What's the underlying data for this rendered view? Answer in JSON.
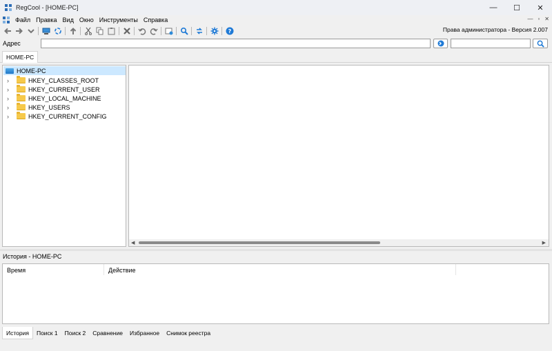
{
  "window": {
    "title": "RegCool - [HOME-PC]",
    "controls": {
      "minimize": "—",
      "maximize": "☐",
      "close": "✕"
    }
  },
  "menu": {
    "items": [
      "Файл",
      "Правка",
      "Вид",
      "Окно",
      "Инструменты",
      "Справка"
    ],
    "mdi_controls": [
      "—",
      "▫",
      "✕"
    ]
  },
  "toolbar": {
    "buttons": [
      "back-icon",
      "forward-icon",
      "dropdown-icon",
      "computer-icon",
      "refresh-icon",
      "up-icon",
      "cut-icon",
      "copy-icon",
      "paste-icon",
      "delete-icon",
      "undo-icon",
      "redo-icon",
      "new-key-icon",
      "find-icon",
      "compare-icon",
      "settings-icon",
      "help-icon"
    ],
    "rights_text": "Права администратора - Версия 2.007"
  },
  "address": {
    "label": "Адрес",
    "value": "",
    "search_value": ""
  },
  "tabs": {
    "main": "HOME-PC"
  },
  "tree": {
    "root": "HOME-PC",
    "children": [
      "HKEY_CLASSES_ROOT",
      "HKEY_CURRENT_USER",
      "HKEY_LOCAL_MACHINE",
      "HKEY_USERS",
      "HKEY_CURRENT_CONFIG"
    ]
  },
  "history": {
    "title": "История - HOME-PC",
    "columns": [
      "Время",
      "Действие"
    ]
  },
  "bottom_tabs": [
    "История",
    "Поиск 1",
    "Поиск 2",
    "Сравнение",
    "Избранное",
    "Снимок реестра"
  ],
  "colors": {
    "accent": "#2b6cb5",
    "selection": "#cce8ff",
    "folder": "#f6c94b"
  }
}
